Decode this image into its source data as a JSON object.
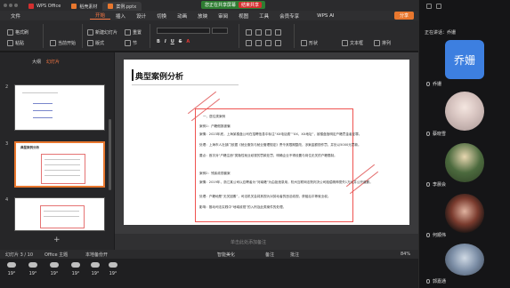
{
  "tabbar": {
    "tabs": [
      {
        "label": "WPS Office",
        "color": "#d32f2f"
      },
      {
        "label": "稻壳素材",
        "color": "#e8772e"
      },
      {
        "label": "案例.pptx",
        "color": "#e8772e"
      }
    ],
    "share_notice": "您正在共享屏幕",
    "stop_share": "结束共享"
  },
  "menubar": {
    "items": [
      "文件",
      "开始",
      "插入",
      "设计",
      "切换",
      "动画",
      "放映",
      "审阅",
      "视图",
      "工具",
      "会员专享"
    ],
    "active": "开始",
    "ai_label": "WPS AI",
    "share_label": "分享"
  },
  "toolbar": {
    "format_painter": "格式刷",
    "paste": "粘贴",
    "from_current": "当前开始",
    "new_slide": "新建幻灯片",
    "layout": "版式",
    "reset": "重置",
    "section": "节",
    "text_box": "文本框",
    "shapes": "形状",
    "arrange": "排列"
  },
  "left_panel": {
    "tab_outline": "大纲",
    "tab_slides": "幻灯片",
    "slide_numbers": [
      "2",
      "3",
      "4"
    ]
  },
  "slide": {
    "title": "典型案例分析",
    "lines": [
      "一、居住类案例",
      "案例1：户籍假报被骗",
      "案情：2023年底，上海某楼盘公司在招聘信息中标注“XX电话费”“XX、XX地址”，被楼盘指明定户籍罚金者定罪。",
      "处理：上海市人社部门依据《就业服务与就业管理规定》责令其限期整改，涉案金额视作罚，并处以5000元罚款。",
      "要点：首次对“户籍注册”类隐性就业歧视的罚款处罚，明确企业不得设置与岗位无关的户籍限制。",
      "",
      "案例2：残疾歧视套案",
      "案情：2019年，浙江某公司以应聘者为“河南籍”为由拒绝录用，杭州互联网法院判决公司赔偿精神损失1万元并公开道歉。",
      "处理：户籍地是“无关因素”，司法机关会将其视为对劳动者的违法歧视，获赔后平等就业权。",
      "影响：推动司法实践中“地域歧视”的入刑及此类案件的处理。"
    ],
    "notes_placeholder": "单击此处添加备注"
  },
  "statusbar": {
    "slide_info": "幻灯片 3 / 10",
    "theme": "Office 主题",
    "cloud": "本地备份开",
    "smart_beautify": "智能美化",
    "notes": "备注",
    "comments": "批注",
    "zoom": "84%"
  },
  "weather": {
    "temps": [
      "19°",
      "19°",
      "19°",
      "19°",
      "19°",
      "19°"
    ]
  },
  "right_panel": {
    "speaking": "正在讲话：乔姗",
    "participants": [
      {
        "name": "乔姗",
        "avatar_text": "乔姗"
      },
      {
        "name": "蔡晓雪"
      },
      {
        "name": "李晨会"
      },
      {
        "name": "何顺伟"
      },
      {
        "name": "郭嘉通"
      }
    ]
  },
  "colors": {
    "accent": "#e8772e",
    "active_tab": "#ff7a45",
    "box_border": "#ef5350",
    "avatar_blue": "#3d7fe0"
  }
}
